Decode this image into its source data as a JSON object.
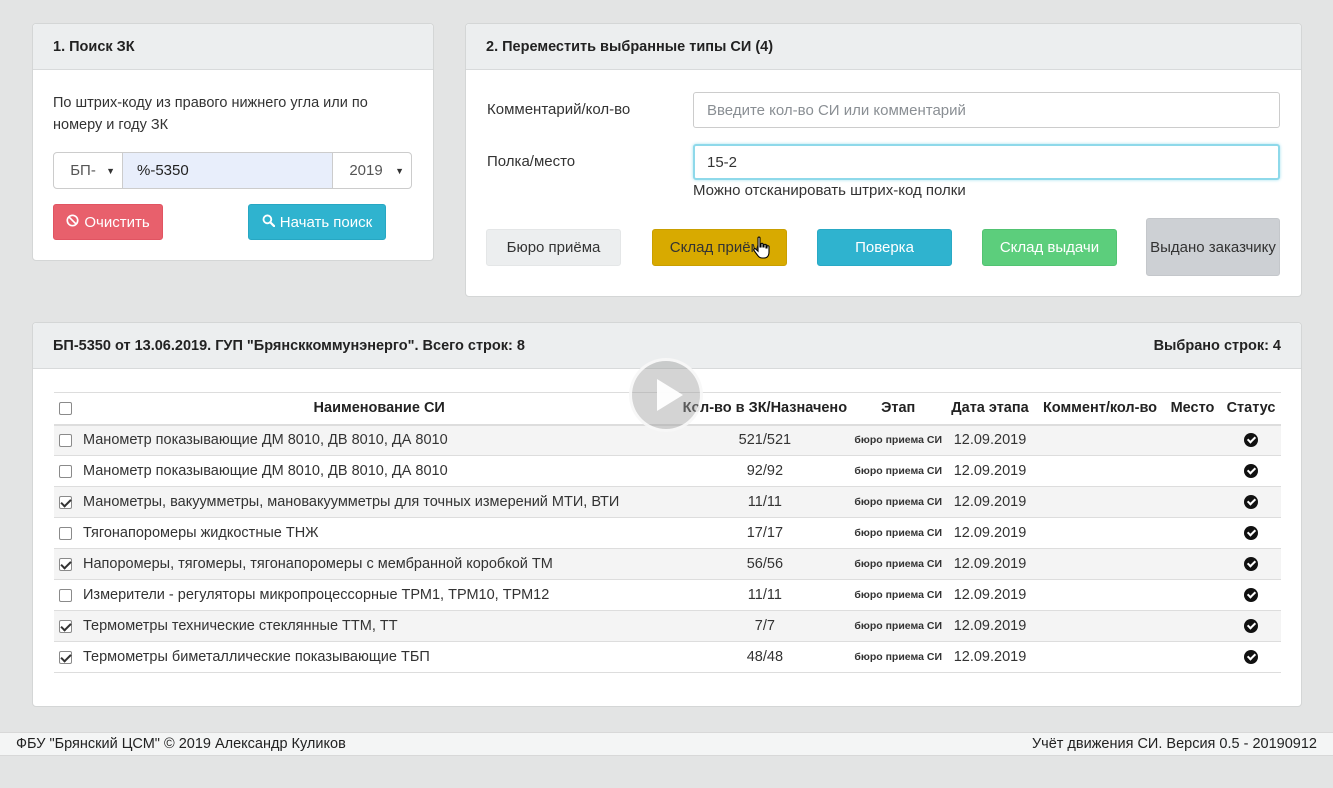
{
  "search": {
    "header": "1. Поиск ЗК",
    "description": "По штрих-коду из правого нижнего угла или по номеру и году ЗК",
    "prefix": "БП-",
    "code_value": "%-5350",
    "year": "2019",
    "clear_label": "Очистить",
    "search_label": "Начать поиск"
  },
  "move": {
    "header": "2. Переместить выбранные типы СИ (4)",
    "comment_label": "Комментарий/кол-во",
    "comment_placeholder": "Введите кол-во СИ или комментарий",
    "shelf_label": "Полка/место",
    "shelf_value": "15-2",
    "shelf_help": "Можно отсканировать штрих-код полки",
    "buttons": {
      "reception": "Бюро приёма",
      "warehouse_in": "Склад приёма",
      "verification": "Поверка",
      "warehouse_out": "Склад выдачи",
      "issued": "Выдано заказчику"
    },
    "colors": {
      "warehouse_in": "#d8aa00",
      "verification": "#2fb3cf",
      "warehouse_out": "#5cce7c",
      "issued": "#cdd0d4"
    }
  },
  "order": {
    "header": "БП-5350 от 13.06.2019. ГУП \"Брянсккоммунэнерго\". Всего строк: 8",
    "selected": "Выбрано строк: 4",
    "columns": {
      "name": "Наименование СИ",
      "qty": "Кол-во в ЗК/Назначено",
      "stage": "Этап",
      "date": "Дата этапа",
      "comment": "Коммент/кол-во",
      "place": "Место",
      "status": "Статус"
    },
    "rows": [
      {
        "checked": false,
        "name": "Манометр показывающие ДМ 8010, ДВ 8010, ДА 8010",
        "qty": "521/521",
        "stage": "бюро приема СИ",
        "date": "12.09.2019",
        "comment": "",
        "place": "",
        "status": "check-circle-icon"
      },
      {
        "checked": false,
        "name": "Манометр показывающие ДМ 8010, ДВ 8010, ДА 8010",
        "qty": "92/92",
        "stage": "бюро приема СИ",
        "date": "12.09.2019",
        "comment": "",
        "place": "",
        "status": "check-circle-icon"
      },
      {
        "checked": true,
        "name": "Манометры, вакуумметры, мановакуумметры для точных измерений МТИ, ВТИ",
        "qty": "11/11",
        "stage": "бюро приема СИ",
        "date": "12.09.2019",
        "comment": "",
        "place": "",
        "status": "check-circle-icon"
      },
      {
        "checked": false,
        "name": "Тягонапоромеры жидкостные ТНЖ",
        "qty": "17/17",
        "stage": "бюро приема СИ",
        "date": "12.09.2019",
        "comment": "",
        "place": "",
        "status": "check-circle-icon"
      },
      {
        "checked": true,
        "name": "Напоромеры, тягомеры, тягонапоромеры с мембранной коробкой ТМ",
        "qty": "56/56",
        "stage": "бюро приема СИ",
        "date": "12.09.2019",
        "comment": "",
        "place": "",
        "status": "check-circle-icon"
      },
      {
        "checked": false,
        "name": "Измерители - регуляторы микропроцессорные ТРМ1, ТРМ10, ТРМ12",
        "qty": "11/11",
        "stage": "бюро приема СИ",
        "date": "12.09.2019",
        "comment": "",
        "place": "",
        "status": "check-circle-icon"
      },
      {
        "checked": true,
        "name": "Термометры технические стеклянные ТТМ, ТТ",
        "qty": "7/7",
        "stage": "бюро приема СИ",
        "date": "12.09.2019",
        "comment": "",
        "place": "",
        "status": "check-circle-icon"
      },
      {
        "checked": true,
        "name": "Термометры биметаллические показывающие ТБП",
        "qty": "48/48",
        "stage": "бюро приема СИ",
        "date": "12.09.2019",
        "comment": "",
        "place": "",
        "status": "check-circle-icon"
      }
    ]
  },
  "footer": {
    "left": "ФБУ \"Брянский ЦСМ\" © 2019 Александр Куликов",
    "right": "Учёт движения СИ. Версия 0.5 - 20190912"
  },
  "overlay": {
    "icon": "play-icon"
  }
}
